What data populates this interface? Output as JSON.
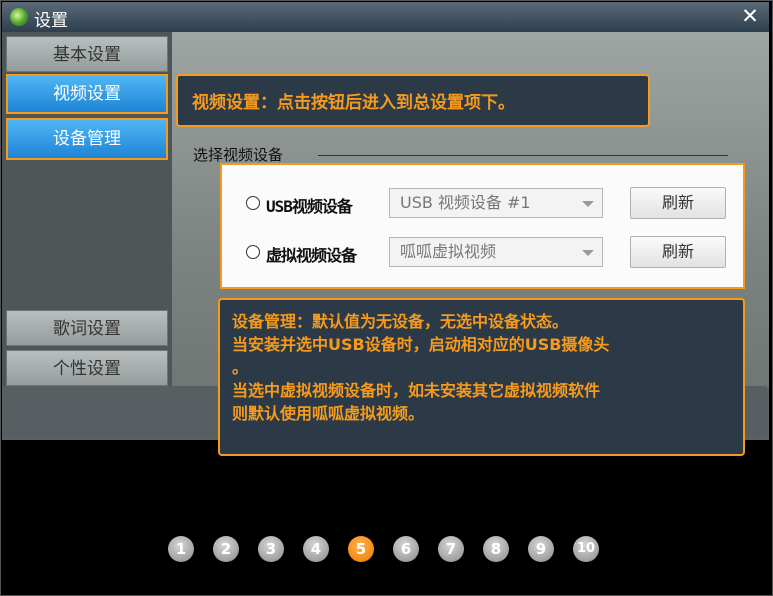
{
  "window": {
    "title": "设置",
    "close_glyph": "✕"
  },
  "sidebar": {
    "items": [
      {
        "label": "基本设置",
        "active": false
      },
      {
        "label": "视频设置",
        "active": true
      },
      {
        "label": "设备管理",
        "active": true
      },
      {
        "label": "歌词设置",
        "active": false
      },
      {
        "label": "个性设置",
        "active": false
      }
    ]
  },
  "video_device": {
    "group_title": "选择视频设备",
    "rows": [
      {
        "label": "USB视频设备",
        "selected_value": "USB 视频设备 #1",
        "refresh_label": "刷新"
      },
      {
        "label": "虚拟视频设备",
        "selected_value": "呱呱虚拟视频",
        "refresh_label": "刷新"
      }
    ]
  },
  "callouts": {
    "video_settings": "视频设置：点击按钮后进入到总设置项下。",
    "device_management": [
      "设备管理：默认值为无设备，无选中设备状态。",
      "当安装并选中USB设备时，启动相对应的USB摄像头",
      "。",
      "当选中虚拟视频设备时，如未安装其它虚拟视频软件",
      "则默认使用呱呱虚拟视频。"
    ]
  },
  "pager": {
    "pages": [
      "1",
      "2",
      "3",
      "4",
      "5",
      "6",
      "7",
      "8",
      "9",
      "10"
    ],
    "current": "5"
  },
  "colors": {
    "accent": "#f59a1d",
    "active_tab": "#1e84d6",
    "callout_bg": "#2b3a46"
  }
}
